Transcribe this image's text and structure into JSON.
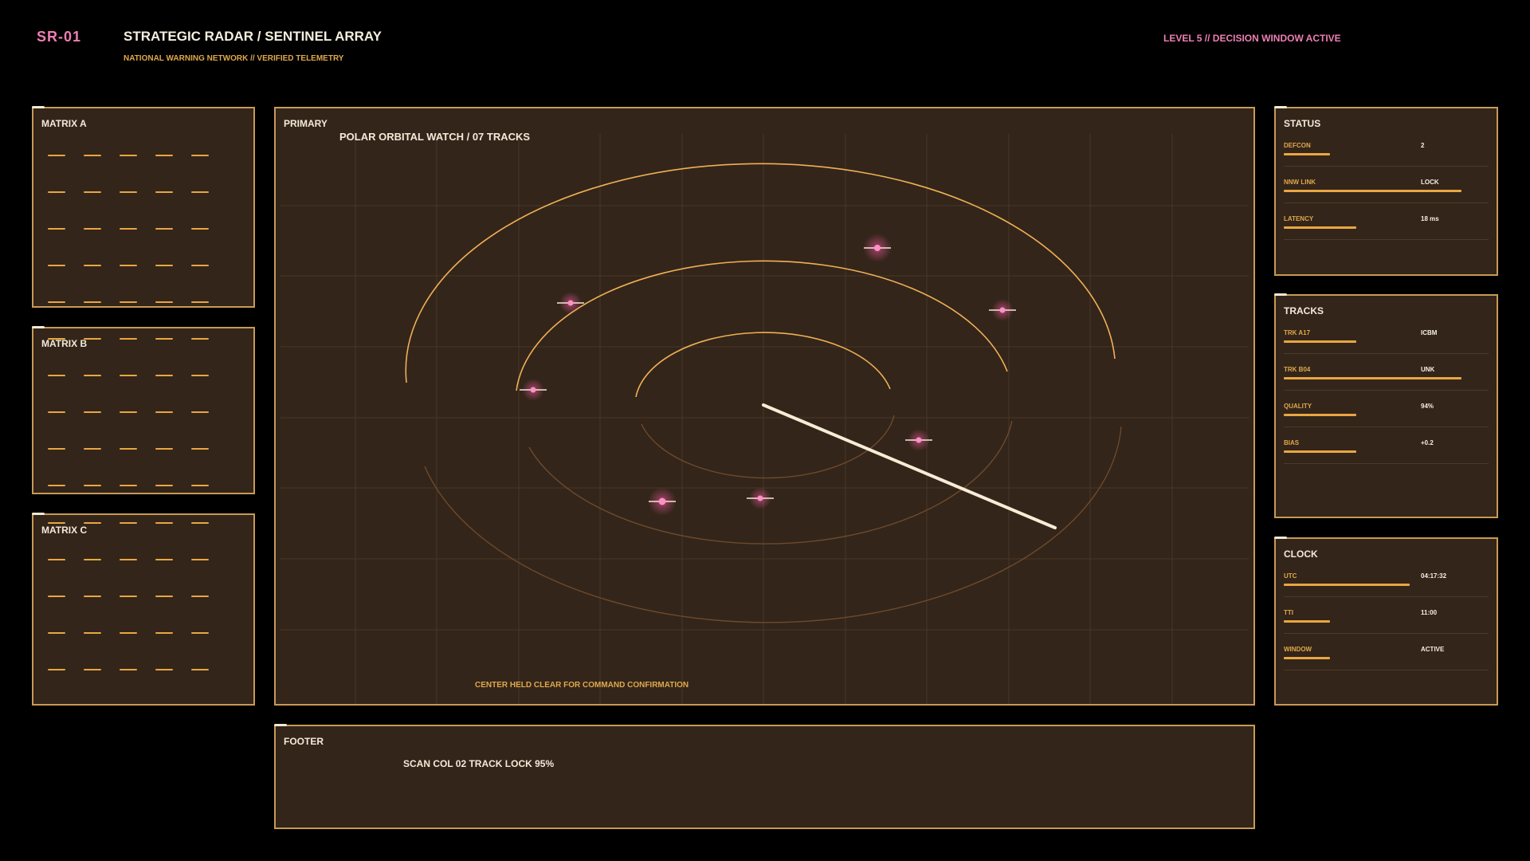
{
  "header": {
    "brand": "SR-01",
    "title": "STRATEGIC RADAR / SENTINEL ARRAY",
    "subtitle": "NATIONAL WARNING NETWORK // VERIFIED TELEMETRY",
    "level": "LEVEL 5 // DECISION WINDOW ACTIVE"
  },
  "matrices": [
    {
      "label": "MATRIX A"
    },
    {
      "label": "MATRIX B"
    },
    {
      "label": "MATRIX C"
    }
  ],
  "primary": {
    "label": "PRIMARY",
    "subtitle": "POLAR ORBITAL WATCH / 07 TRACKS",
    "note": "CENTER HELD CLEAR FOR COMMAND CONFIRMATION"
  },
  "footer": {
    "label": "FOOTER",
    "text": "SCAN COL 02  TRACK LOCK 95%"
  },
  "status": {
    "label": "STATUS",
    "rows": [
      {
        "key": "DEFCON",
        "value": "2",
        "level": 0.26
      },
      {
        "key": "NNW LINK",
        "value": "LOCK",
        "level": 1.0
      },
      {
        "key": "LATENCY",
        "value": "18 ms",
        "level": 0.41
      }
    ]
  },
  "tracks": {
    "label": "TRACKS",
    "rows": [
      {
        "key": "TRK A17",
        "value": "ICBM",
        "level": 0.41
      },
      {
        "key": "TRK B04",
        "value": "UNK",
        "level": 1.0
      },
      {
        "key": "QUALITY",
        "value": "94%",
        "level": 0.41
      },
      {
        "key": "BIAS",
        "value": "+0.2",
        "level": 0.41
      }
    ]
  },
  "clock": {
    "label": "CLOCK",
    "rows": [
      {
        "key": "UTC",
        "value": "04:17:32",
        "level": 0.71
      },
      {
        "key": "TTI",
        "value": "11:00",
        "level": 0.26
      },
      {
        "key": "WINDOW",
        "value": "ACTIVE",
        "level": 0.26
      }
    ]
  },
  "colors": {
    "accent": "#e9a642",
    "panel_bg": "#33251a",
    "panel_border": "#c79a55",
    "pink": "#ee7fb4",
    "text": "#f3ead8"
  }
}
